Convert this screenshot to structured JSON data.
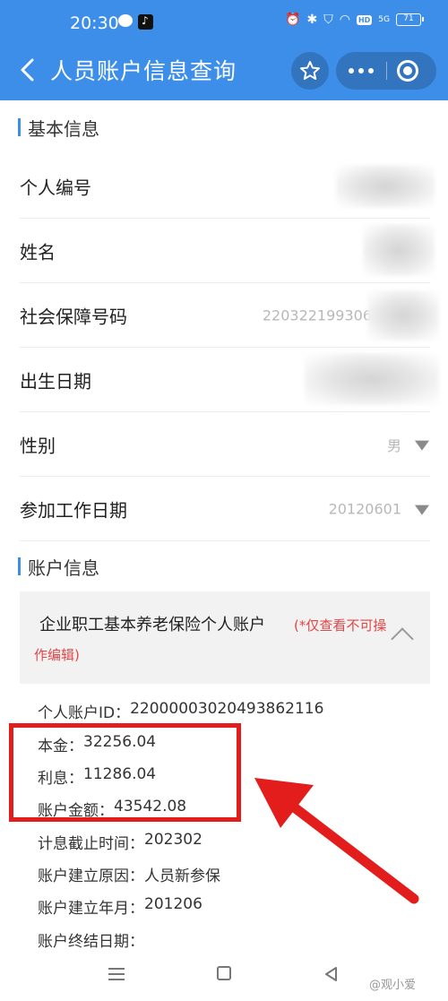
{
  "status": {
    "time": "20:30",
    "battery": "71",
    "network_label": "5G",
    "hd_label": "HD"
  },
  "navbar": {
    "title": "人员账户信息查询"
  },
  "basic_section": {
    "title": "基本信息",
    "rows": [
      {
        "label": "个人编号",
        "value": ""
      },
      {
        "label": "姓名",
        "value": ""
      },
      {
        "label": "社会保障号码",
        "value": "220322199306"
      },
      {
        "label": "出生日期",
        "value": ""
      },
      {
        "label": "性别",
        "value": "男"
      },
      {
        "label": "参加工作日期",
        "value": "20120601"
      }
    ]
  },
  "account_section": {
    "title": "账户信息",
    "card": {
      "name": "企业职工基本养老保险个人账户",
      "note_part1": "(*仅查看不可操",
      "note_part2": "作编辑)"
    },
    "details": [
      {
        "label": "个人账户ID：",
        "value": "22000003020493862116"
      },
      {
        "label": "本金：",
        "value": "32256.04"
      },
      {
        "label": "利息：",
        "value": "11286.04"
      },
      {
        "label": "账户金额：",
        "value": "43542.08"
      },
      {
        "label": "计息截止时间：",
        "value": "202302"
      },
      {
        "label": "账户建立原因：",
        "value": "人员新参保"
      },
      {
        "label": "账户建立年月：",
        "value": "201206"
      },
      {
        "label": "账户终结日期：",
        "value": ""
      }
    ]
  },
  "watermark": "@观小爱",
  "colors": {
    "brand_blue": "#3d8ee8",
    "highlight_red": "#e31c1c",
    "note_red": "#e24646"
  }
}
